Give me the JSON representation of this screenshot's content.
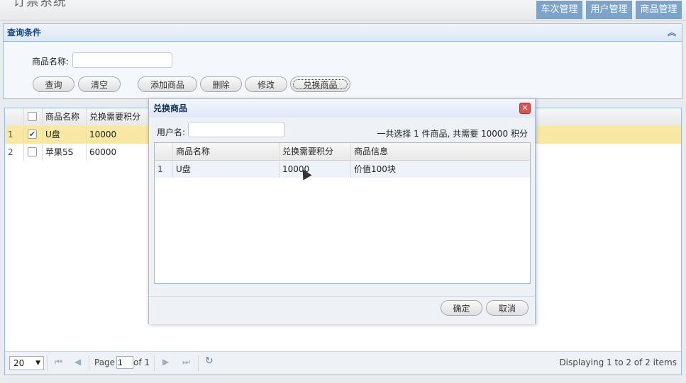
{
  "header": {
    "app_title": "订票系统",
    "nav_tabs": [
      "车次管理",
      "用户管理",
      "商品管理"
    ]
  },
  "query": {
    "title": "查询条件",
    "field_label": "商品名称:",
    "field_value": "",
    "buttons": {
      "search": "查询",
      "clear": "清空",
      "add": "添加商品",
      "delete": "删除",
      "edit": "修改",
      "exchange": "兑换商品"
    }
  },
  "grid": {
    "columns": [
      "商品名称",
      "兑换需要积分"
    ],
    "rows": [
      {
        "num": "1",
        "name": "U盘",
        "points": "10000",
        "checked": true
      },
      {
        "num": "2",
        "name": "苹果5S",
        "points": "60000",
        "checked": false
      }
    ],
    "pager": {
      "page_size": "20",
      "page_label": "Page",
      "page_value": "1",
      "of_label": "of 1",
      "info": "Displaying 1 to 2 of 2 items"
    }
  },
  "dialog": {
    "title": "兑换商品",
    "user_label": "用户名:",
    "user_value": "",
    "summary": "一共选择 1 件商品, 共需要 10000 积分",
    "columns": [
      "商品名称",
      "兑换需要积分",
      "商品信息"
    ],
    "rows": [
      {
        "num": "1",
        "name": "U盘",
        "points": "10000",
        "info": "价值100块"
      }
    ],
    "confirm_label": "确定",
    "cancel_label": "取消"
  }
}
